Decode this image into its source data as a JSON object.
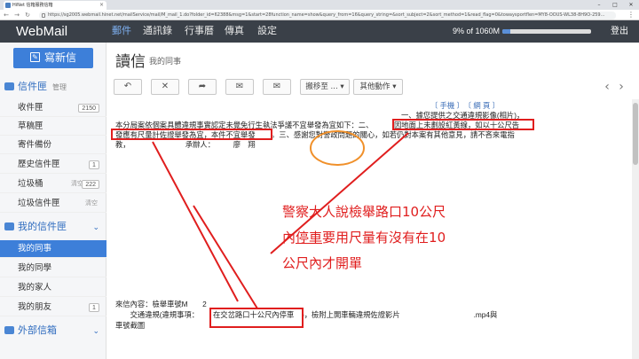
{
  "browser": {
    "tab_title": "HiNet 信箱服務信箱",
    "url": "https://sg2005.webmail.hinet.net/mailService/mail/M_mail_1.do?folder_id=62388&msg=1&start=28function_name=show&query_from=16&query_string=&sort_subject=2&sort_method=1&read_flag=0&towaysportflen=MY8-OOUS-WL38-8H9O-259..."
  },
  "topnav": {
    "logo": "WebMail",
    "items": [
      "郵件",
      "通訊錄",
      "行事曆",
      "傳真",
      "設定"
    ],
    "active_index": 0,
    "quota_text": "9% of 1060M",
    "quota_fraction": 0.09,
    "logout": "登出"
  },
  "sidebar": {
    "compose_label": "寫新信",
    "inbox_head": {
      "label": "信件匣",
      "sub": "管理"
    },
    "folders": [
      {
        "label": "收件匣",
        "count": "2150"
      },
      {
        "label": "草稿匣",
        "count": ""
      },
      {
        "label": "寄件備份",
        "count": ""
      },
      {
        "label": "歷史信件匣",
        "count": "1"
      },
      {
        "label": "垃圾桶",
        "count": "222",
        "action": "清空"
      },
      {
        "label": "垃圾信件匣",
        "count": "",
        "action": "清空"
      }
    ],
    "my_folders_head": {
      "label": "我的信件匣"
    },
    "my_folders": [
      {
        "label": "我的同事",
        "active": true
      },
      {
        "label": "我的同學"
      },
      {
        "label": "我的家人"
      },
      {
        "label": "我的朋友",
        "count": "1"
      }
    ],
    "external_head": {
      "label": "外部信箱"
    }
  },
  "main": {
    "title": "讀信",
    "subtitle": "我的同事",
    "toolbar": {
      "move_label": "搬移至 ...",
      "other_label": "其他動作"
    }
  },
  "mail": {
    "line_links": "〔 手機 〕　〔 網 頁 〕",
    "line1": "一、據您提供之交通違規影像(相片)，",
    "line2a": "本分局案依個案具體違規事實認定未覺免行生執法爭議不宜舉發為宜如下：二、",
    "line2b": "因地面上未劃設紅黃線，如以十公尺告",
    "line3a": "發應有尺量計佐證舉發為宜，本件不宜舉發",
    "line3b": "。三、感謝您對警政問題的關心，如若仍對本案有其他意見，請不吝來電指",
    "line4": "教，　　　　　　　　承辦人：　　　廖　翔",
    "blank1": "",
    "content_label": "來信內容：檢舉車號M　　2",
    "content_line1a": "　　交通違規(違規事項：",
    "content_line1b": "在交岔路口十公尺內停車",
    "content_line1c": ")，檢附上開車輛違規佐證影片　　　　　　　　　　.mp4與",
    "content_line2": "車號截圖"
  },
  "annotation": {
    "line1": "警察大人說檢舉路口10公尺",
    "line2_pre": "內",
    "line2_u": "停車",
    "line2_post": "要用尺量有沒有在10",
    "line3": "公尺內才開單"
  }
}
